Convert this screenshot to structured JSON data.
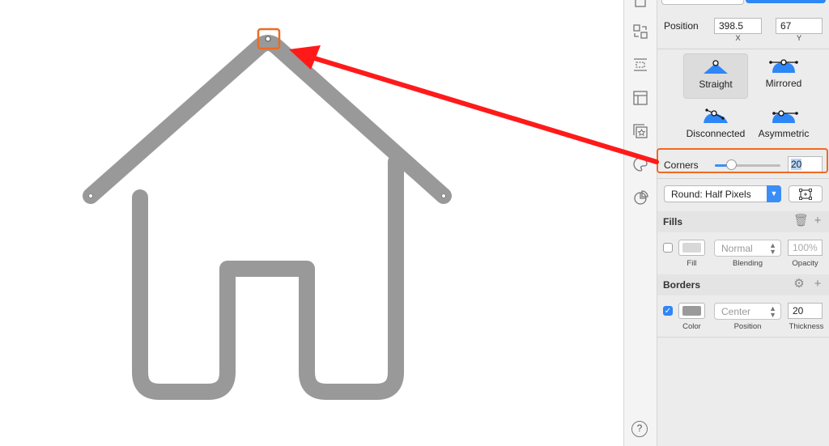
{
  "position": {
    "label": "Position",
    "x_value": "398.5",
    "y_value": "67",
    "x_caption": "X",
    "y_caption": "Y"
  },
  "curve_types": [
    {
      "label": "Straight",
      "selected": true,
      "icon": "curve-straight-icon"
    },
    {
      "label": "Mirrored",
      "selected": false,
      "icon": "curve-mirrored-icon"
    },
    {
      "label": "Disconnected",
      "selected": false,
      "icon": "curve-disconnected-icon"
    },
    {
      "label": "Asymmetric",
      "selected": false,
      "icon": "curve-asymmetric-icon"
    }
  ],
  "corners": {
    "label": "Corners",
    "value": "20",
    "slider_fraction": 0.25
  },
  "pixel_mode": {
    "selected": "Round: Half Pixels"
  },
  "fills": {
    "title": "Fills",
    "enabled": false,
    "swatch_color": "#d8d8d8",
    "blending": "Normal",
    "opacity": "100%",
    "fill_caption": "Fill",
    "blending_caption": "Blending",
    "opacity_caption": "Opacity"
  },
  "borders": {
    "title": "Borders",
    "enabled": true,
    "swatch_color": "#9a9a9a",
    "position": "Center",
    "thickness": "20",
    "color_caption": "Color",
    "position_caption": "Position",
    "thickness_caption": "Thickness"
  },
  "help": {
    "label": "?"
  },
  "colors": {
    "accent": "#3a8ef6",
    "highlight": "#ee6a24",
    "arrow": "#ff1a1a",
    "stroke": "#999999"
  }
}
